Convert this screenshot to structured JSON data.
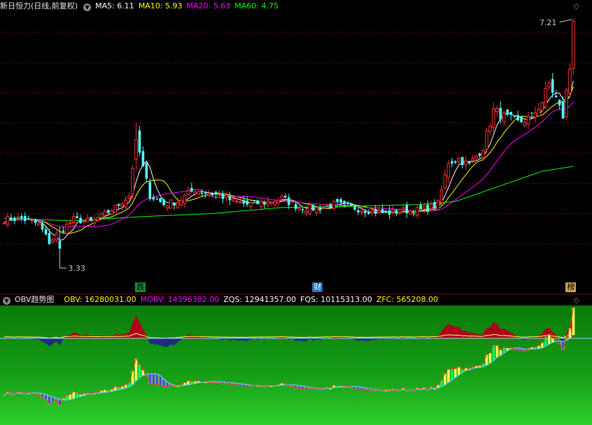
{
  "main_panel": {
    "title": "新日恒力(日线,前复权)",
    "ma_labels": [
      {
        "text": "MA5: 6.11",
        "color": "#ffffff"
      },
      {
        "text": "MA10: 5.93",
        "color": "#ffff00"
      },
      {
        "text": "MA20: 5.63",
        "color": "#ff00ff"
      },
      {
        "text": "MA60: 4.75",
        "color": "#00ff00"
      }
    ],
    "high_label": "7.21",
    "low_label": "3.33",
    "markers": [
      {
        "text": "跌",
        "index": 39,
        "bg": "#1c8a36",
        "color": "#000000"
      },
      {
        "text": "财",
        "index": 90,
        "bg": "#1f6fb8",
        "color": "#ffffff"
      },
      {
        "text": "榜",
        "index": 163,
        "bg": "#c8a050",
        "color": "#000000"
      }
    ]
  },
  "sub_panel": {
    "title": "OBV趋势图",
    "labels": [
      {
        "text": "OBV: 16280031.00",
        "color": "#ffff00"
      },
      {
        "text": "MOBV: 14396382.00",
        "color": "#ff00ff"
      },
      {
        "text": "ZQS: 12941357.00",
        "color": "#ffffff"
      },
      {
        "text": "FQS: 10115313.00",
        "color": "#ffffff"
      },
      {
        "text": "ZFC: 565208.00",
        "color": "#ffff00"
      }
    ]
  },
  "chart_data": {
    "type": "candlestick",
    "bars": 165,
    "price_range": [
      3.0,
      7.3
    ],
    "price_gridlines": [
      3.5,
      4.0,
      4.5,
      5.0,
      5.5,
      6.0,
      6.5,
      7.0
    ],
    "anchors_close": [
      [
        0,
        3.9
      ],
      [
        5,
        3.92
      ],
      [
        10,
        3.82
      ],
      [
        13,
        3.52
      ],
      [
        16,
        3.7
      ],
      [
        20,
        3.9
      ],
      [
        25,
        3.86
      ],
      [
        28,
        3.95
      ],
      [
        32,
        4.1
      ],
      [
        36,
        4.3
      ],
      [
        38,
        5.25
      ],
      [
        40,
        4.75
      ],
      [
        42,
        4.3
      ],
      [
        46,
        4.15
      ],
      [
        50,
        4.2
      ],
      [
        55,
        4.4
      ],
      [
        58,
        4.35
      ],
      [
        62,
        4.3
      ],
      [
        66,
        4.2
      ],
      [
        70,
        4.15
      ],
      [
        75,
        4.18
      ],
      [
        80,
        4.25
      ],
      [
        85,
        4.1
      ],
      [
        90,
        4.08
      ],
      [
        95,
        4.15
      ],
      [
        100,
        4.1
      ],
      [
        105,
        4.05
      ],
      [
        110,
        4.0
      ],
      [
        115,
        4.05
      ],
      [
        120,
        4.05
      ],
      [
        125,
        4.15
      ],
      [
        128,
        4.85
      ],
      [
        131,
        4.9
      ],
      [
        134,
        4.8
      ],
      [
        138,
        5.1
      ],
      [
        141,
        5.7
      ],
      [
        144,
        5.6
      ],
      [
        148,
        5.5
      ],
      [
        152,
        5.6
      ],
      [
        155,
        5.85
      ],
      [
        157,
        6.15
      ],
      [
        159,
        5.9
      ],
      [
        161,
        5.6
      ],
      [
        162,
        6.0
      ],
      [
        163,
        6.4
      ],
      [
        164,
        7.21
      ]
    ],
    "anchors_ma60": [
      [
        0,
        3.92
      ],
      [
        20,
        3.88
      ],
      [
        40,
        3.95
      ],
      [
        60,
        4.0
      ],
      [
        80,
        4.1
      ],
      [
        100,
        4.12
      ],
      [
        120,
        4.15
      ],
      [
        130,
        4.2
      ],
      [
        145,
        4.5
      ],
      [
        155,
        4.7
      ],
      [
        164,
        4.78
      ]
    ],
    "high": 7.21,
    "low": 3.33,
    "ma5": 6.11,
    "ma10": 5.93,
    "ma20": 5.63,
    "ma60": 4.75,
    "obv": 16280031.0,
    "mobv": 14396382.0,
    "zqs": 12941357.0,
    "fqs": 10115313.0,
    "zfc": 565208.0
  }
}
